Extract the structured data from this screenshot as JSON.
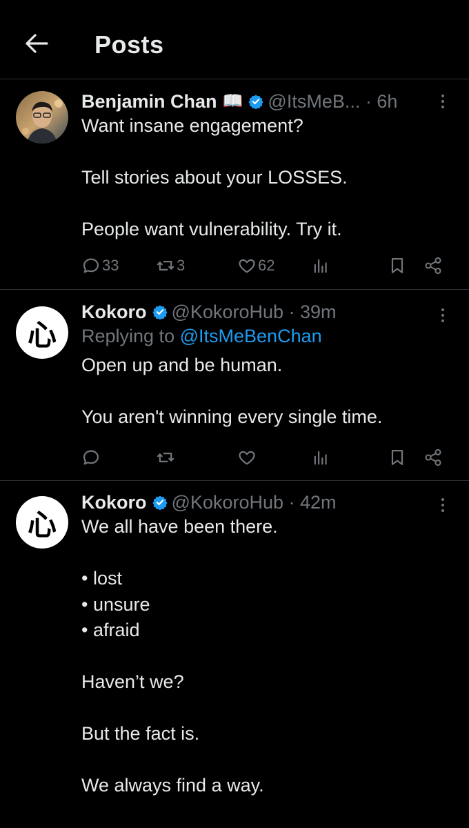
{
  "header": {
    "title": "Posts"
  },
  "posts": [
    {
      "name": "Benjamin Chan",
      "emoji": "📖",
      "handle": "@ItsMeB...",
      "time": "6h",
      "lines": [
        "Want insane engagement?",
        "",
        "Tell stories about your LOSSES.",
        "",
        "People want vulnerability. Try it."
      ],
      "stats": {
        "replies": "33",
        "reposts": "3",
        "likes": "62"
      }
    },
    {
      "name": "Kokoro",
      "handle": "@KokoroHub",
      "time": "39m",
      "replying_prefix": "Replying to",
      "replying_to": "@ItsMeBenChan",
      "lines": [
        "Open up and be human.",
        "",
        "You aren't winning every single time."
      ]
    },
    {
      "name": "Kokoro",
      "handle": "@KokoroHub",
      "time": "42m",
      "lines": [
        "We all have been there.",
        "",
        "• lost",
        "• unsure",
        "• afraid",
        "",
        "Haven’t we?",
        "",
        "But the fact is.",
        "",
        "We always find a way."
      ]
    }
  ],
  "avatar_glyph": "心",
  "colors": {
    "background": "#000000",
    "text": "#e7e9ea",
    "muted": "#71767b",
    "link": "#1d9bf0",
    "verified": "#1d9bf0",
    "divider": "#2f3336"
  }
}
